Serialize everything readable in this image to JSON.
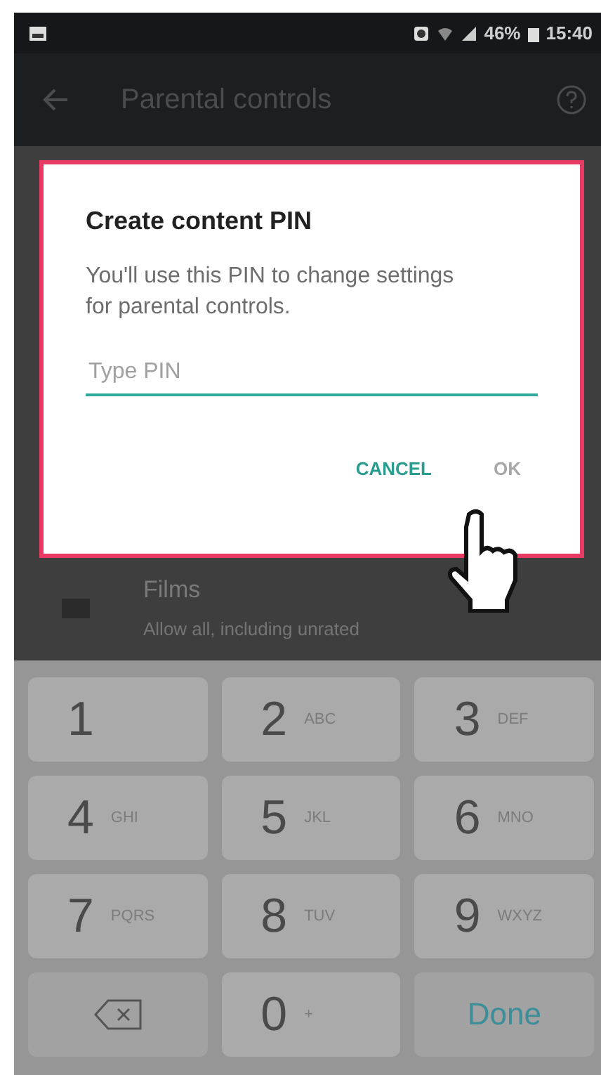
{
  "status_bar": {
    "battery": "46%",
    "time": "15:40"
  },
  "app_bar": {
    "title": "Parental controls"
  },
  "list_item": {
    "title": "Films",
    "subtitle": "Allow all, including unrated"
  },
  "dialog": {
    "title": "Create content PIN",
    "message": "You'll use this PIN to change settings for parental controls.",
    "pin_field": {
      "placeholder": "Type PIN"
    },
    "buttons": [
      {
        "label": "CANCEL",
        "disabled": false
      },
      {
        "label": "OK",
        "disabled": true
      }
    ]
  },
  "keypad": [
    {
      "kind": "digit",
      "label": "1"
    },
    {
      "kind": "digit",
      "label": "2",
      "letters": "ABC"
    },
    {
      "kind": "digit",
      "label": "3",
      "letters": "DEF"
    },
    {
      "kind": "digit",
      "label": "4",
      "letters": "GHI"
    },
    {
      "kind": "digit",
      "label": "5",
      "letters": "JKL"
    },
    {
      "kind": "digit",
      "label": "6",
      "letters": "MNO"
    },
    {
      "kind": "digit",
      "label": "7",
      "letters": "PQRS"
    },
    {
      "kind": "digit",
      "label": "8",
      "letters": "TUV"
    },
    {
      "kind": "digit",
      "label": "9",
      "letters": "WXYZ"
    },
    {
      "kind": "backspace"
    },
    {
      "kind": "digit",
      "label": "0",
      "letters": "+"
    },
    {
      "kind": "done",
      "label": "Done"
    }
  ]
}
